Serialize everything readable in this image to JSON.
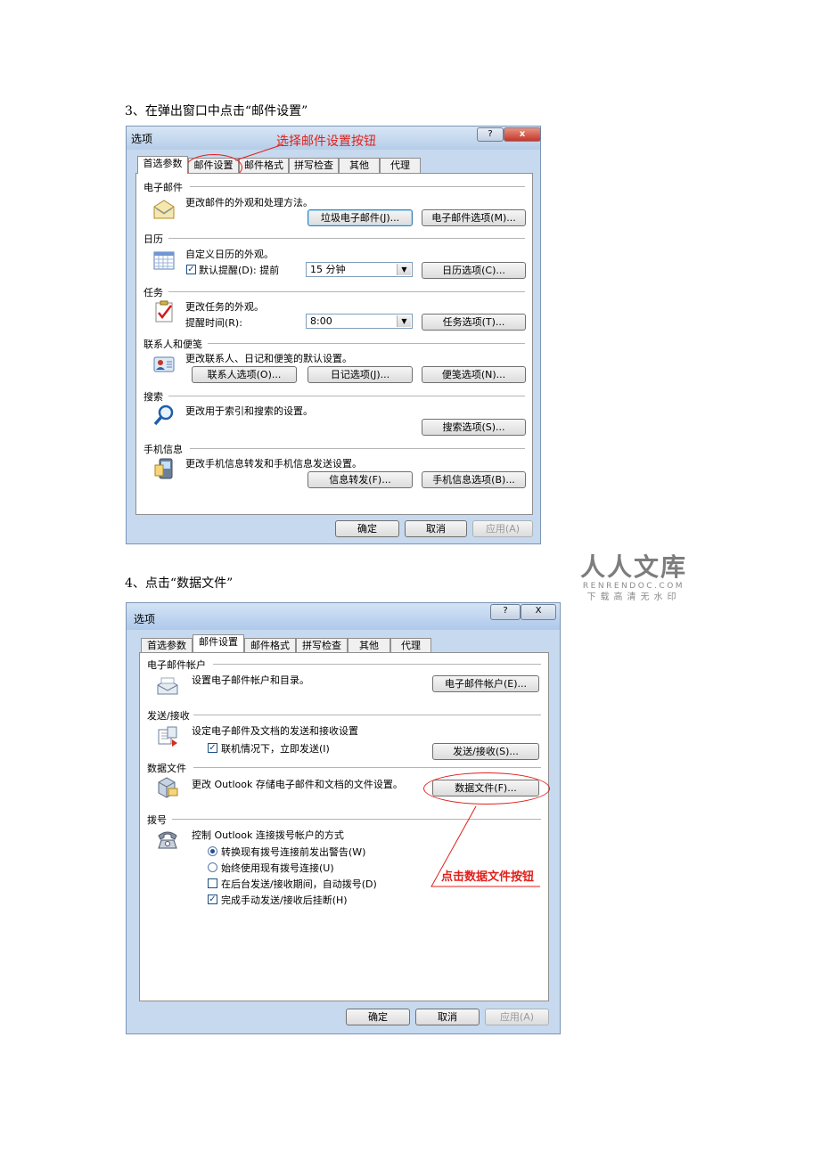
{
  "step3": "3、在弹出窗口中点击“邮件设置”",
  "step4": "4、点击“数据文件”",
  "watermark": {
    "big": "人人文库",
    "url": "RENRENDOC.COM",
    "slogan": "下载高清无水印"
  },
  "dialog1": {
    "title": "选项",
    "help": "?",
    "close": "x",
    "annotation": "选择邮件设置按钮",
    "tabs": [
      "首选参数",
      "邮件设置",
      "邮件格式",
      "拼写检查",
      "其他",
      "代理"
    ],
    "sections": {
      "email": {
        "title": "电子邮件",
        "desc": "更改邮件的外观和处理方法。",
        "btn1": "垃圾电子邮件(J)...",
        "btn2": "电子邮件选项(M)..."
      },
      "calendar": {
        "title": "日历",
        "desc": "自定义日历的外观。",
        "check": "默认提醒(D): 提前",
        "select": "15 分钟",
        "btn": "日历选项(C)..."
      },
      "tasks": {
        "title": "任务",
        "desc": "更改任务的外观。",
        "label": "提醒时间(R):",
        "select": "8:00",
        "btn": "任务选项(T)..."
      },
      "contacts": {
        "title": "联系人和便笺",
        "desc": "更改联系人、日记和便笺的默认设置。",
        "btn1": "联系人选项(O)...",
        "btn2": "日记选项(J)...",
        "btn3": "便笺选项(N)..."
      },
      "search": {
        "title": "搜索",
        "desc": "更改用于索引和搜索的设置。",
        "btn": "搜索选项(S)..."
      },
      "mobile": {
        "title": "手机信息",
        "desc": "更改手机信息转发和手机信息发送设置。",
        "btn1": "信息转发(F)...",
        "btn2": "手机信息选项(B)..."
      }
    },
    "ok": "确定",
    "cancel": "取消",
    "apply": "应用(A)"
  },
  "dialog2": {
    "title": "选项",
    "help": "?",
    "close": "X",
    "annotation": "点击数据文件按钮",
    "tabs": [
      "首选参数",
      "邮件设置",
      "邮件格式",
      "拼写检查",
      "其他",
      "代理"
    ],
    "sections": {
      "accounts": {
        "title": "电子邮件帐户",
        "desc": "设置电子邮件帐户和目录。",
        "btn": "电子邮件帐户(E)..."
      },
      "sendrecv": {
        "title": "发送/接收",
        "desc": "设定电子邮件及文档的发送和接收设置",
        "check": "联机情况下，立即发送(I)",
        "btn": "发送/接收(S)..."
      },
      "datafiles": {
        "title": "数据文件",
        "desc": "更改 Outlook 存储电子邮件和文档的文件设置。",
        "btn": "数据文件(F)..."
      },
      "dialup": {
        "title": "拨号",
        "desc": "控制 Outlook 连接拨号帐户的方式",
        "opt1": "转换现有拨号连接前发出警告(W)",
        "opt2": "始终使用现有拨号连接(U)",
        "opt3": "在后台发送/接收期间，自动拨号(D)",
        "opt4": "完成手动发送/接收后挂断(H)"
      }
    },
    "ok": "确定",
    "cancel": "取消",
    "apply": "应用(A)"
  }
}
